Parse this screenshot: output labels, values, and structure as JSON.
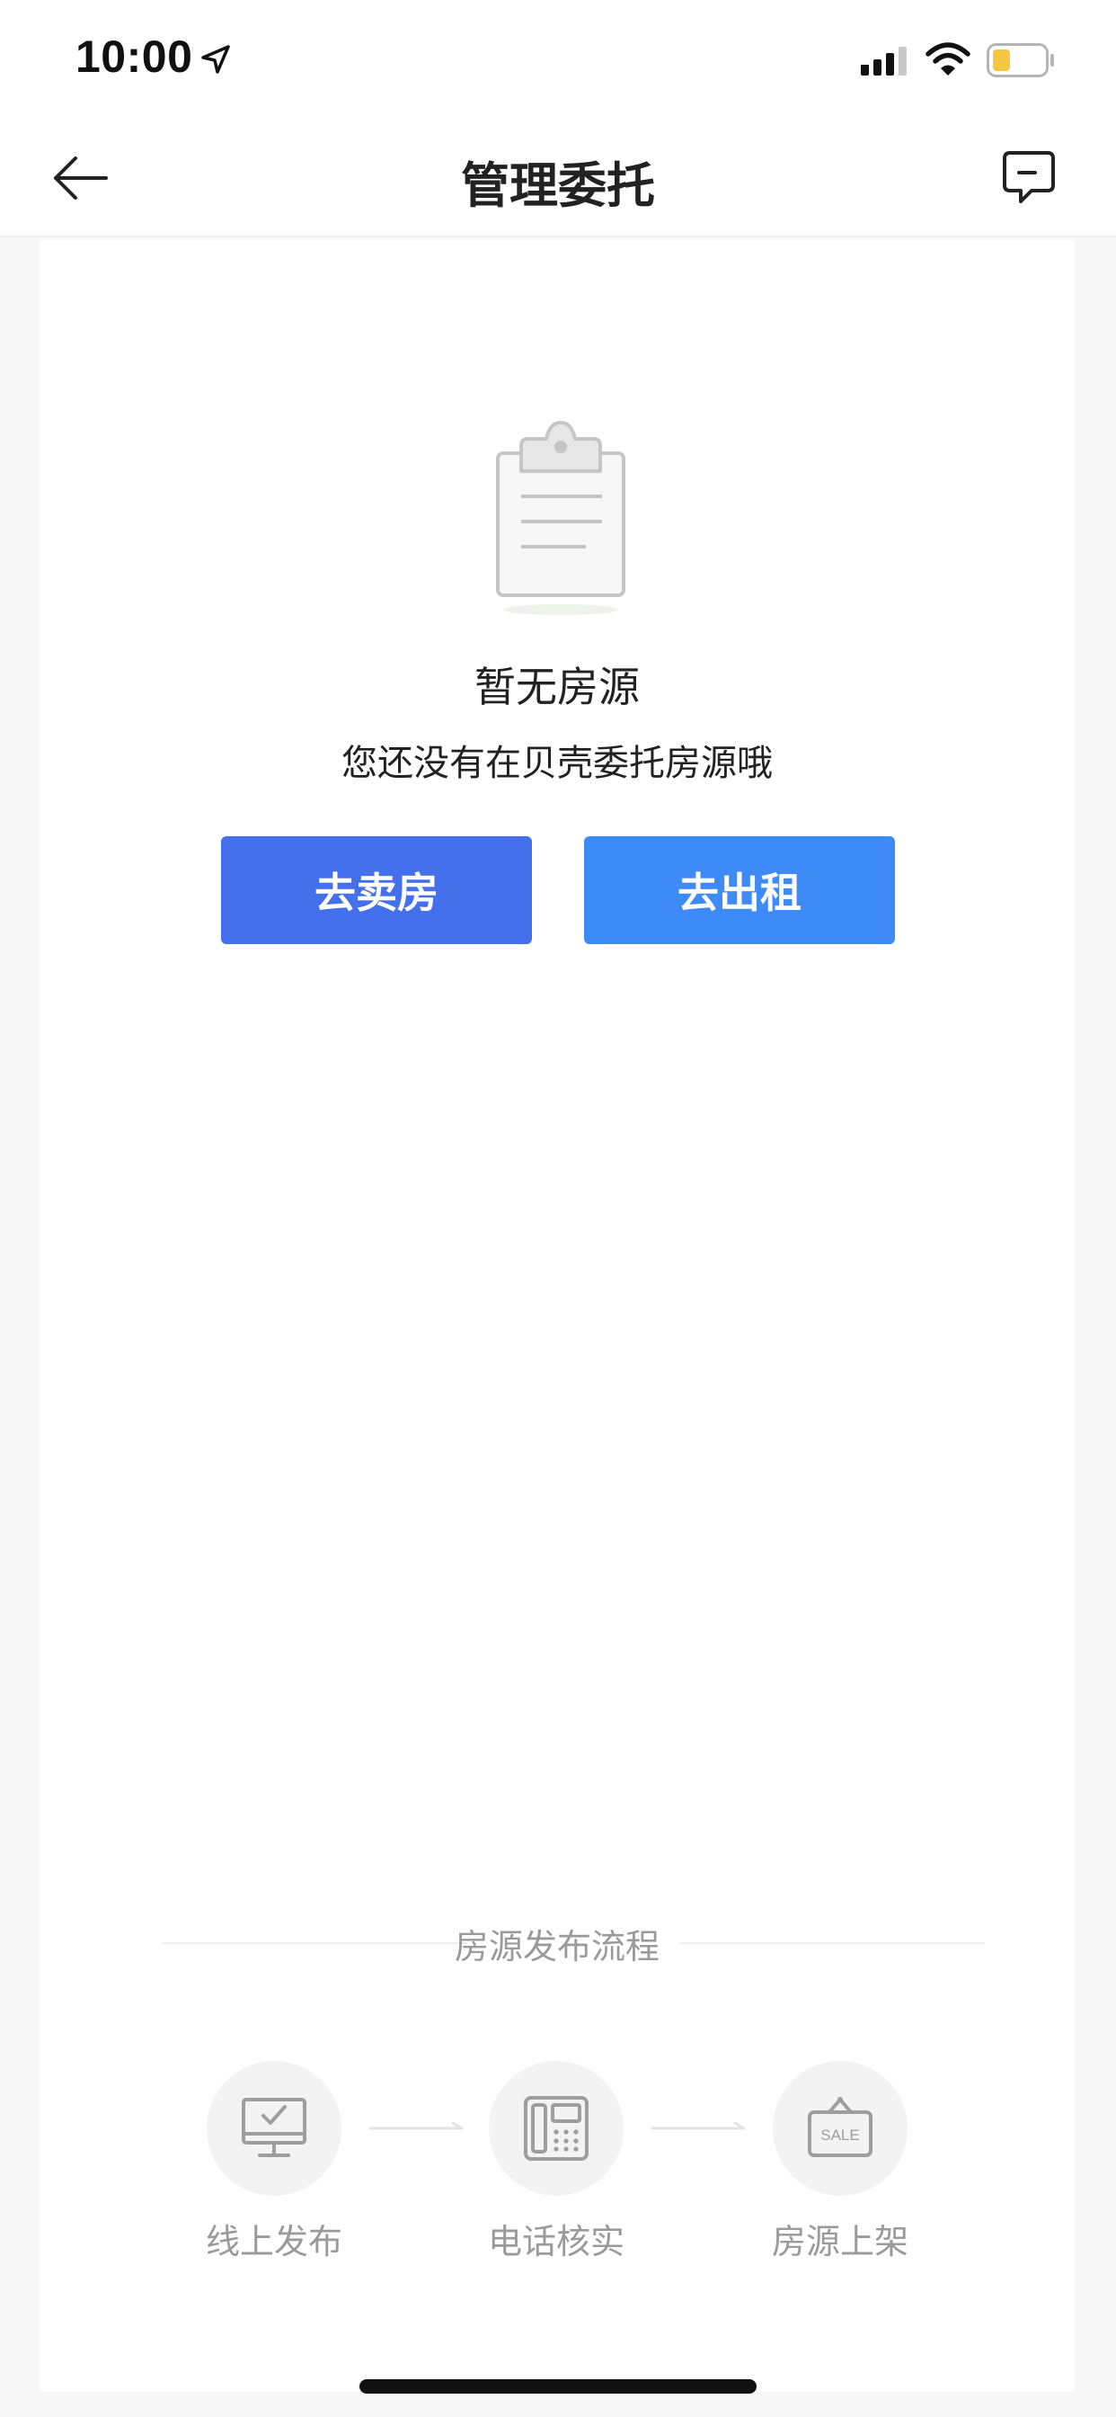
{
  "status_bar": {
    "time": "10:00",
    "icons": [
      "location-arrow-icon",
      "signal-icon",
      "wifi-icon",
      "battery-icon"
    ],
    "battery_color": "#f5c842"
  },
  "nav": {
    "title": "管理委托",
    "back_icon": "back-arrow-icon",
    "message_icon": "message-icon"
  },
  "empty_state": {
    "icon": "clipboard-icon",
    "title": "暂无房源",
    "description": "您还没有在贝壳委托房源哦"
  },
  "actions": {
    "sell_label": "去卖房",
    "rent_label": "去出租",
    "sell_color": "#4470eb",
    "rent_color": "#3e8af7"
  },
  "process": {
    "title": "房源发布流程",
    "steps": [
      {
        "label": "线上发布",
        "icon": "monitor-check-icon"
      },
      {
        "label": "电话核实",
        "icon": "telephone-icon"
      },
      {
        "label": "房源上架",
        "icon": "sale-sign-icon",
        "sign_text": "SALE"
      }
    ]
  }
}
